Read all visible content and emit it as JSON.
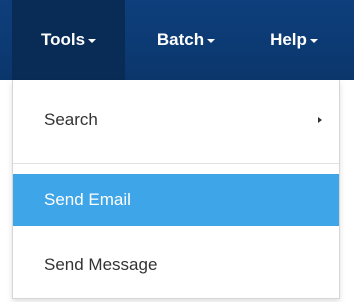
{
  "navbar": {
    "items": [
      {
        "label": "Tools",
        "icon": "caret-down-icon",
        "active": true
      },
      {
        "label": "Batch",
        "icon": "caret-down-icon",
        "active": false
      },
      {
        "label": "Help",
        "icon": "caret-down-icon",
        "active": false
      }
    ]
  },
  "dropdown": {
    "items": [
      {
        "label": "Search",
        "icon": "chevron-right-icon",
        "has_submenu": true
      },
      {
        "label": "Send Email",
        "highlighted": true
      },
      {
        "label": "Send Message"
      }
    ]
  },
  "colors": {
    "navbar_bg": "#0e3f7c",
    "navbar_active_bg": "#092c57",
    "highlight_bg": "#3da5e8",
    "menu_text": "#333333"
  }
}
